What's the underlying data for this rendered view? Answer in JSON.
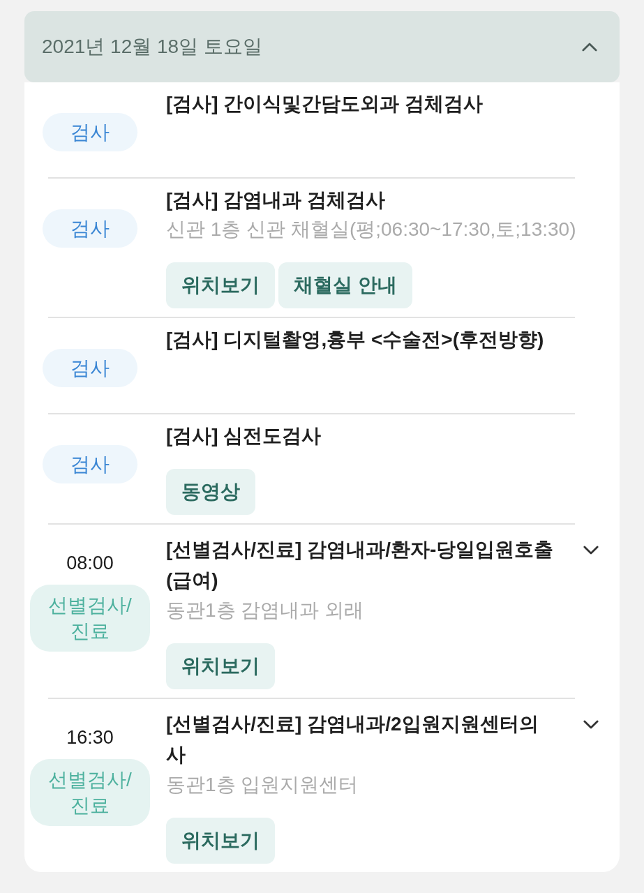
{
  "header": {
    "date": "2021년 12월 18일 토요일",
    "expanded": true
  },
  "items": [
    {
      "kind": "exam",
      "category": "검사",
      "title": "[검사] 간이식및간담도외과 검체검사"
    },
    {
      "kind": "exam",
      "category": "검사",
      "title": "[검사] 감염내과 검체검사",
      "location": "신관 1층 신관 채혈실(평;06:30~17:30,토;13:30)",
      "actions": [
        "위치보기",
        "채혈실 안내"
      ]
    },
    {
      "kind": "exam",
      "category": "검사",
      "title": "[검사] 디지털촬영,흉부 <수술전>(후전방향)"
    },
    {
      "kind": "exam",
      "category": "검사",
      "title": "[검사] 심전도검사",
      "actions": [
        "동영상"
      ]
    },
    {
      "kind": "visit",
      "time": "08:00",
      "category": "선별검사/진료",
      "title": "[선별검사/진료] 감염내과/환자-당일입원호출(급여)",
      "location": "동관1층 감염내과 외래",
      "actions": [
        "위치보기"
      ]
    },
    {
      "kind": "visit",
      "time": "16:30",
      "category": "선별검사/진료",
      "title": "[선별검사/진료] 감염내과/2입원지원센터의사",
      "location": "동관1층 입원지원센터",
      "actions": [
        "위치보기"
      ]
    }
  ]
}
